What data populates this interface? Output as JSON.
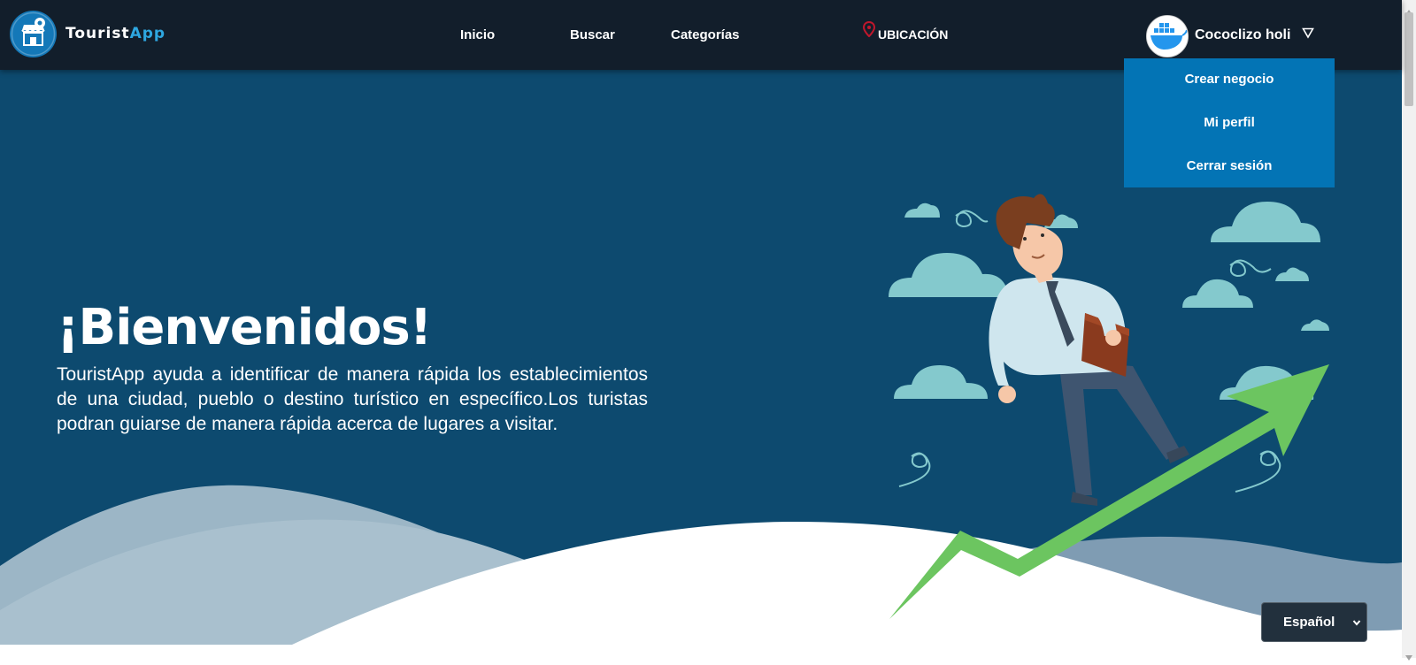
{
  "brand": {
    "name_part1": "Tourist",
    "name_part2": "App",
    "logo_icon": "store-pin-icon"
  },
  "nav": {
    "links": [
      {
        "label": "Inicio"
      },
      {
        "label": "Buscar"
      },
      {
        "label": "Categorías"
      }
    ],
    "location": {
      "label": "UBICACIÓN",
      "icon": "map-pin-icon"
    },
    "user": {
      "name": "Cococlizo holi",
      "avatar_icon": "docker-whale-avatar",
      "caret_icon": "triangle-down-icon"
    }
  },
  "user_menu": {
    "items": [
      {
        "label": "Crear negocio"
      },
      {
        "label": "Mi perfil"
      },
      {
        "label": "Cerrar sesión"
      }
    ]
  },
  "hero": {
    "title": "¡Bienvenidos!",
    "description": "TouristApp ayuda a identificar de manera rápida los establecimientos de una ciudad, pueblo o destino turístico en específico.Los turistas podran guiarse de manera rápida acerca de lugares a visitar.",
    "illustration": "businessman-on-growth-arrow"
  },
  "language": {
    "selected": "Español",
    "icon": "chevron-down-icon"
  },
  "colors": {
    "navbar": "#121e2b",
    "hero": "#0d4a6f",
    "dropdown": "#0374b5",
    "arrow": "#6cc560",
    "cloud": "#84c9cd",
    "brand_accent": "#2ea7e0",
    "pin": "#c0172c"
  }
}
